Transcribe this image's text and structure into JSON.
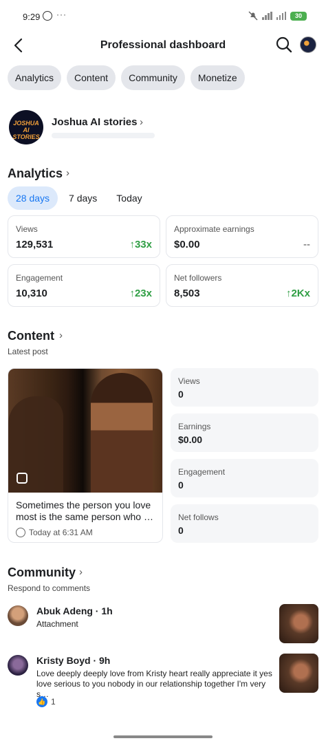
{
  "status_bar": {
    "time": "9:29",
    "dots": "···",
    "battery": "30"
  },
  "header": {
    "title": "Professional dashboard"
  },
  "tabs": [
    "Analytics",
    "Content",
    "Community",
    "Monetize"
  ],
  "profile": {
    "name": "Joshua AI stories",
    "avatar_text": "JOSHUA AI STORIES"
  },
  "analytics": {
    "title": "Analytics",
    "ranges": [
      "28 days",
      "7 days",
      "Today"
    ],
    "active_range": "28 days",
    "metrics": [
      {
        "label": "Views",
        "value": "129,531",
        "change": "↑33x"
      },
      {
        "label": "Approximate earnings",
        "value": "$0.00",
        "change": "--"
      },
      {
        "label": "Engagement",
        "value": "10,310",
        "change": "↑23x"
      },
      {
        "label": "Net followers",
        "value": "8,503",
        "change": "↑2Kx"
      }
    ]
  },
  "content": {
    "title": "Content",
    "subtitle": "Latest post",
    "post": {
      "caption": "Sometimes the person you love most is the same person who …",
      "time": "Today at 6:31 AM"
    },
    "stats": [
      {
        "label": "Views",
        "value": "0"
      },
      {
        "label": "Earnings",
        "value": "$0.00"
      },
      {
        "label": "Engagement",
        "value": "0"
      },
      {
        "label": "Net follows",
        "value": "0"
      }
    ]
  },
  "community": {
    "title": "Community",
    "subtitle": "Respond to comments",
    "comments": [
      {
        "name": "Abuk Adeng · 1h",
        "text": "Attachment"
      },
      {
        "name": "Kristy Boyd · 9h",
        "text": "Love deeply deeply love from Kristy heart really appreciate it yes love serious to you nobody in our relationship together I'm very s…",
        "likes": "1"
      }
    ]
  },
  "colors": {
    "accent": "#1877f2",
    "positive": "#2f9e44",
    "chip_bg": "#e4e6eb"
  }
}
